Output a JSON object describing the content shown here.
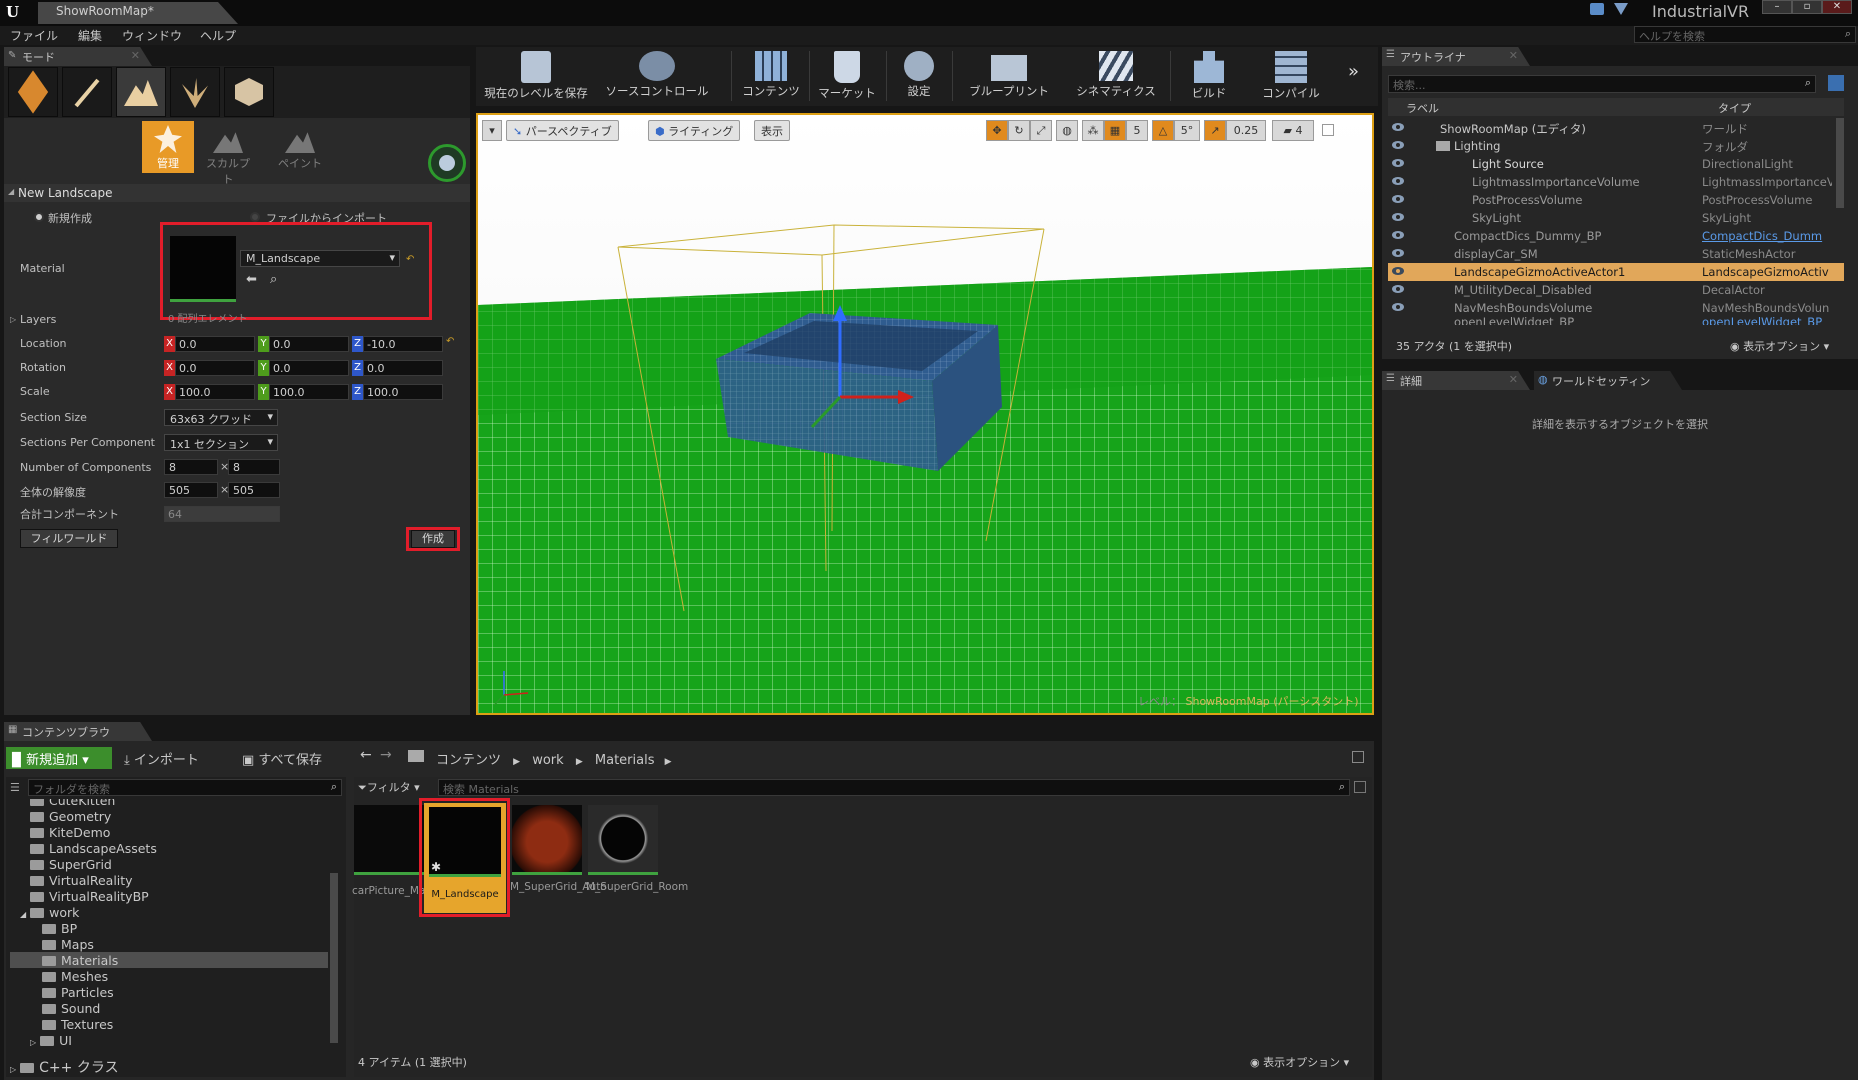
{
  "app": {
    "tab_title": "ShowRoomMap*",
    "project_name": "IndustrialVR",
    "help_search_placeholder": "ヘルプを検索"
  },
  "menu": [
    "ファイル",
    "編集",
    "ウィンドウ",
    "ヘルプ"
  ],
  "modes": {
    "tab_label": "モード",
    "sub_tools": [
      "管理",
      "スカルプト",
      "ペイント"
    ],
    "section_title": "New Landscape",
    "radio_new": "新規作成",
    "radio_import": "ファイルからインポート",
    "material_label": "Material",
    "material_value": "M_Landscape",
    "layers_label": "Layers",
    "layers_hint": "0 配列エレメント",
    "location_label": "Location",
    "location": [
      "0.0",
      "0.0",
      "-10.0"
    ],
    "rotation_label": "Rotation",
    "rotation": [
      "0.0",
      "0.0",
      "0.0"
    ],
    "scale_label": "Scale",
    "scale": [
      "100.0",
      "100.0",
      "100.0"
    ],
    "axis": [
      "X",
      "Y",
      "Z"
    ],
    "section_size_label": "Section Size",
    "section_size": "63x63 クワッド",
    "sections_per_component_label": "Sections Per Component",
    "sections_per_component": "1x1 セクション",
    "num_components_label": "Number of Components",
    "num_components": [
      "8",
      "8"
    ],
    "resolution_label": "全体の解像度",
    "resolution": [
      "505",
      "505"
    ],
    "times": "×",
    "total_components_label": "合計コンポーネント",
    "total_components": "64",
    "fill_world_button": "フィルワールド",
    "create_button": "作成"
  },
  "toolbar": [
    "現在のレベルを保存",
    "ソースコントロール",
    "コンテンツ",
    "マーケット",
    "設定",
    "ブループリント",
    "シネマティクス",
    "ビルド",
    "コンパイル"
  ],
  "viewport": {
    "perspective": "パースペクティブ",
    "lighting": "ライティング",
    "show": "表示",
    "grid_snap": "5",
    "rot_snap": "5°",
    "scale_snap": "0.25",
    "camera_speed": "4",
    "level_label": "レベル：",
    "level_name": "ShowRoomMap (パーシスタント)"
  },
  "outliner": {
    "tab_label": "アウトライナ",
    "search_placeholder": "検索...",
    "col_label": "ラベル",
    "col_type": "タイプ",
    "rows": [
      {
        "label": "ShowRoomMap (エディタ)",
        "type": "ワールド"
      },
      {
        "label": "Lighting",
        "type": "フォルダ"
      },
      {
        "label": "Light Source",
        "type": "DirectionalLight"
      },
      {
        "label": "LightmassImportanceVolume",
        "type": "LightmassImportanceV"
      },
      {
        "label": "PostProcessVolume",
        "type": "PostProcessVolume"
      },
      {
        "label": "SkyLight",
        "type": "SkyLight"
      },
      {
        "label": "CompactDics_Dummy_BP",
        "type": "CompactDics_Dumm"
      },
      {
        "label": "displayCar_SM",
        "type": "StaticMeshActor"
      },
      {
        "label": "LandscapeGizmoActiveActor1",
        "type": "LandscapeGizmoActiv"
      },
      {
        "label": "M_UtilityDecal_Disabled",
        "type": "DecalActor"
      },
      {
        "label": "NavMeshBoundsVolume",
        "type": "NavMeshBoundsVolun"
      },
      {
        "label": "openLevelWidget_BP",
        "type": "openLevelWidget_BP"
      }
    ],
    "status": "35 アクタ (1 を選択中)",
    "view_options": "表示オプション"
  },
  "details": {
    "tab_label": "詳細",
    "world_settings_tab": "ワールドセッティン",
    "empty_message": "詳細を表示するオブジェクトを選択"
  },
  "content_browser": {
    "tab_label": "コンテンツブラウ",
    "add_new": "新規追加",
    "import": "インポート",
    "save_all": "すべて保存",
    "path": [
      "コンテンツ",
      "work",
      "Materials"
    ],
    "folder_search_placeholder": "フォルダを検索",
    "filters": "フィルタ",
    "asset_search_placeholder": "検索 Materials",
    "folders": [
      "CuteKitten",
      "Geometry",
      "KiteDemo",
      "LandscapeAssets",
      "SuperGrid",
      "VirtualReality",
      "VirtualRealityBP",
      "work",
      "BP",
      "Maps",
      "Materials",
      "Meshes",
      "Particles",
      "Sound",
      "Textures",
      "UI",
      "C++ クラス"
    ],
    "assets": [
      {
        "name": "carPicture_Mat"
      },
      {
        "name": "M_Landscape"
      },
      {
        "name": "M_SuperGrid_Auto"
      },
      {
        "name": "M_SuperGrid_Room"
      }
    ],
    "status": "4 アイテム (1 選択中)",
    "view_options": "表示オプション"
  },
  "colors": {
    "accent": "#e89a27",
    "selection": "#e1a75a",
    "highlight_red": "#e21d2a",
    "grid_green": "#1aa81a"
  }
}
